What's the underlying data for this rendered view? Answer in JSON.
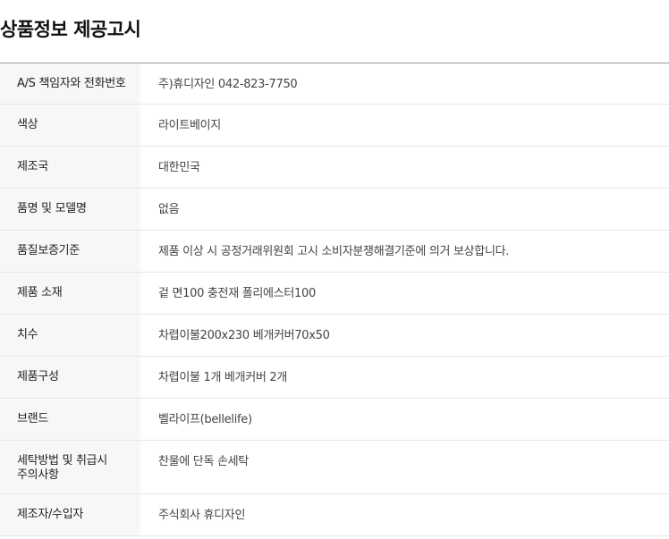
{
  "title": "상품정보 제공고시",
  "rows": [
    {
      "label": "A/S 책임자와 전화번호",
      "value": "주)휴디자인 042-823-7750"
    },
    {
      "label": "색상",
      "value": "라이트베이지"
    },
    {
      "label": "제조국",
      "value": "대한민국"
    },
    {
      "label": "품명 및 모델명",
      "value": "없음"
    },
    {
      "label": "품질보증기준",
      "value": "제품 이상 시 공정거래위원회 고시 소비자분쟁해결기준에 의거 보상합니다."
    },
    {
      "label": "제품 소재",
      "value": "겉 면100 충전재 폴리에스터100"
    },
    {
      "label": "치수",
      "value": "차렵이불200x230 베개커버70x50"
    },
    {
      "label": "제품구성",
      "value": "차렵이불 1개 베개커버 2개"
    },
    {
      "label": "브랜드",
      "value": "벨라이프(bellelife)"
    },
    {
      "label": "세탁방법 및 취급시 주의사항",
      "value": "찬물에 단독 손세탁"
    },
    {
      "label": "제조자/수입자",
      "value": "주식회사 휴디자인"
    }
  ]
}
